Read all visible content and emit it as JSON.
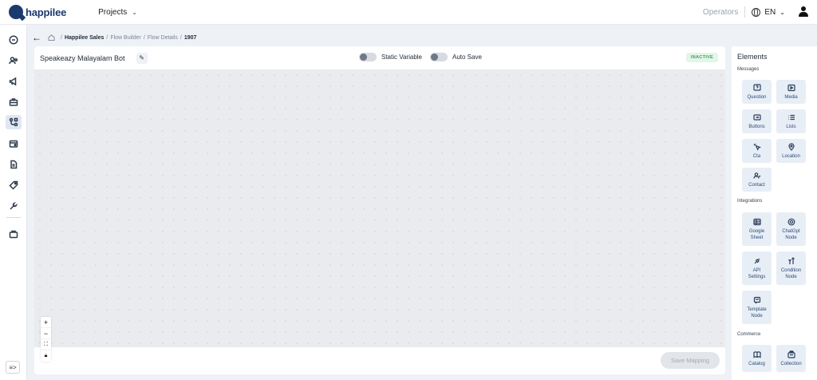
{
  "app": {
    "logo_text": "happilee"
  },
  "topbar": {
    "projects_label": "Projects",
    "operators_label": "Operators",
    "language": "EN"
  },
  "sidebar": {
    "items": [
      {
        "icon": "chat-icon"
      },
      {
        "icon": "users-icon"
      },
      {
        "icon": "megaphone-icon"
      },
      {
        "icon": "briefcase-icon"
      },
      {
        "icon": "flow-icon",
        "active": true
      },
      {
        "icon": "wallet-icon"
      },
      {
        "icon": "document-icon"
      },
      {
        "icon": "tag-icon"
      },
      {
        "icon": "tools-icon"
      },
      {
        "icon": "bag-icon"
      }
    ],
    "collapse_label": "≡>"
  },
  "breadcrumb": {
    "items": [
      "Happilee Sales",
      "Flow Builder",
      "Flow Details",
      "1907"
    ]
  },
  "main": {
    "bot_name": "Speakeazy Malayalam Bot",
    "static_variable_label": "Static Variable",
    "auto_save_label": "Auto Save",
    "status": "INACTIVE",
    "save_label": "Save Mapping"
  },
  "elements": {
    "title": "Elements",
    "sections": {
      "messages": "Messages",
      "integrations": "Integrations",
      "commerce": "Commerce"
    },
    "messages": [
      {
        "label": "Question",
        "icon": "question-icon"
      },
      {
        "label": "Media",
        "icon": "media-icon"
      },
      {
        "label": "Buttons",
        "icon": "buttons-icon"
      },
      {
        "label": "Lists",
        "icon": "list-icon"
      },
      {
        "label": "Cta",
        "icon": "cursor-icon"
      },
      {
        "label": "Location",
        "icon": "location-icon"
      },
      {
        "label": "Contact",
        "icon": "contact-icon"
      }
    ],
    "integrations": [
      {
        "label": "Google Sheet",
        "icon": "sheet-icon"
      },
      {
        "label": "ChatGpt Node",
        "icon": "chatgpt-icon"
      },
      {
        "label": "API Settings",
        "icon": "api-icon"
      },
      {
        "label": "Condition Node",
        "icon": "condition-icon"
      },
      {
        "label": "Template Node",
        "icon": "template-icon"
      }
    ],
    "commerce": [
      {
        "label": "Catalog",
        "icon": "catalog-icon"
      },
      {
        "label": "Collection",
        "icon": "collection-icon"
      }
    ]
  }
}
